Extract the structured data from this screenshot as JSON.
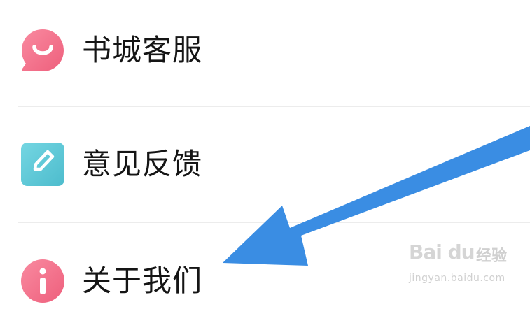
{
  "menu": {
    "items": [
      {
        "label": "书城客服",
        "icon": "customer-service-smile-icon",
        "icon_color": "#f4708a"
      },
      {
        "label": "意见反馈",
        "icon": "feedback-pencil-icon",
        "icon_color": "#59c6d6"
      },
      {
        "label": "关于我们",
        "icon": "info-icon",
        "icon_color": "#f4708a"
      }
    ]
  },
  "annotation": {
    "arrow_color": "#3a8de3"
  },
  "watermark": {
    "brand": "Bai du",
    "suffix": "经验",
    "url": "jingyan.baidu.com"
  }
}
